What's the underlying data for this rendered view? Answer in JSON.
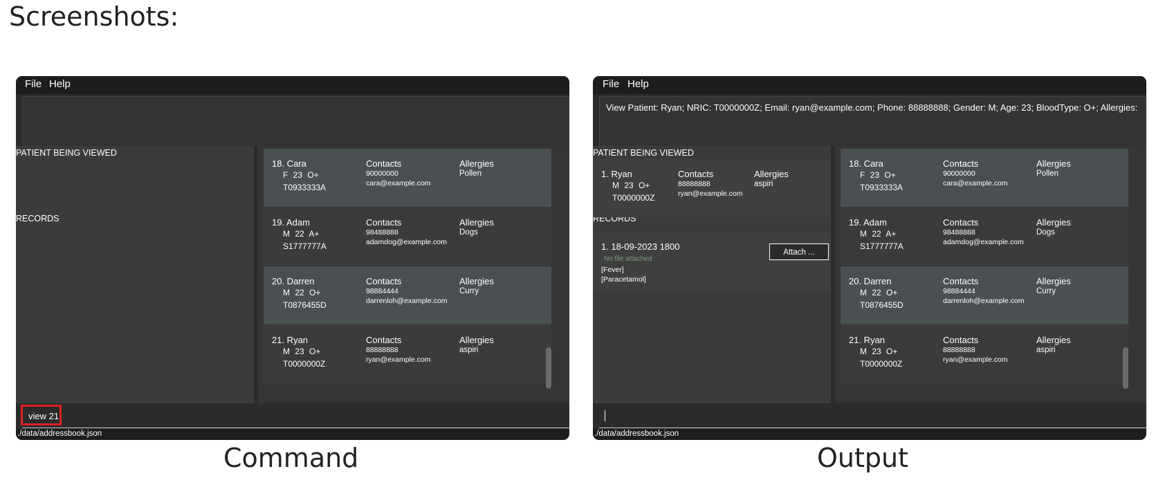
{
  "heading": "Screenshots:",
  "captions": {
    "left": "Command",
    "right": "Output"
  },
  "menu": {
    "file": "File",
    "help": "Help"
  },
  "labels": {
    "patient_being_viewed": "PATIENT BEING VIEWED",
    "records": "RECORDS"
  },
  "status_bar": "./data/addressbook.json",
  "patients": [
    {
      "name": "18. Cara",
      "meta": "F 23 O+",
      "nric": "T0933333A",
      "contacts_label": "Contacts",
      "phone": "90000000",
      "email": "cara@example.com",
      "allergies_label": "Allergies",
      "allergies": "Pollen"
    },
    {
      "name": "19. Adam",
      "meta": "M 22 A+",
      "nric": "S1777777A",
      "contacts_label": "Contacts",
      "phone": "98488888",
      "email": "adamdog@example.com",
      "allergies_label": "Allergies",
      "allergies": "Dogs"
    },
    {
      "name": "20. Darren",
      "meta": "M 22 O+",
      "nric": "T0876455D",
      "contacts_label": "Contacts",
      "phone": "98884444",
      "email": "darrenloh@example.com",
      "allergies_label": "Allergies",
      "allergies": "Curry"
    },
    {
      "name": "21. Ryan",
      "meta": "M 23 O+",
      "nric": "T0000000Z",
      "contacts_label": "Contacts",
      "phone": "88888888",
      "email": "ryan@example.com",
      "allergies_label": "Allergies",
      "allergies": "aspiri"
    }
  ],
  "command_window": {
    "result": "",
    "command_input": "view 21"
  },
  "output_window": {
    "result": "View Patient: Ryan; NRIC: T0000000Z; Email: ryan@example.com; Phone: 88888888; Gender: M; Age: 23; BloodType: O+; Allergies:",
    "command_input": "",
    "viewed_patient": {
      "name": "1. Ryan",
      "meta": "M 23 O+",
      "nric": "T0000000Z",
      "contacts_label": "Contacts",
      "phone": "88888888",
      "email": "ryan@example.com",
      "allergies_label": "Allergies",
      "allergies": "aspiri"
    },
    "record": {
      "title": "1. 18-09-2023 1800",
      "file_status": "No file attached",
      "tag1": "[Fever]",
      "tag2": "[Paracetamol]",
      "attach_button": "Attach ..."
    }
  },
  "colors": {
    "window_bg": "#2b2b2b",
    "card_light": "#4a4f52",
    "card_dark": "#3b3b3b",
    "highlight": "#e02020"
  }
}
